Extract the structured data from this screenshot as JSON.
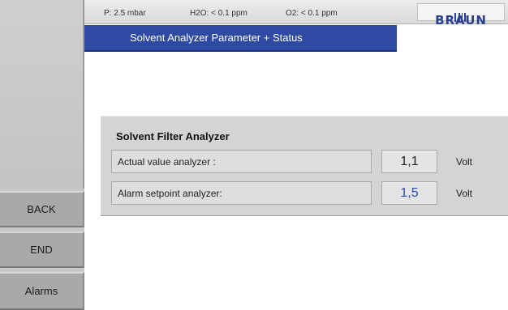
{
  "status_bar": {
    "pressure": "P:   2.5 mbar",
    "h2o": "H2O:   < 0.1 ppm",
    "o2": "O2:   < 0.1 ppm",
    "logo_text": "BRAUN"
  },
  "title_bar": {
    "title": "Solvent Analyzer Parameter + Status"
  },
  "panel": {
    "title": "Solvent Filter Analyzer",
    "rows": [
      {
        "label": "Actual value analyzer :",
        "value": "1,1",
        "unit": "Volt"
      },
      {
        "label": "Alarm setpoint analyzer:",
        "value": "1,5",
        "unit": "Volt"
      }
    ]
  },
  "sidebar": {
    "buttons": [
      {
        "label": "BACK"
      },
      {
        "label": "END"
      },
      {
        "label": "Alarms"
      }
    ]
  },
  "colors": {
    "title_bar": "#2f4aa3",
    "editable_value": "#2b4fb0",
    "logo": "#2a3f8f"
  }
}
